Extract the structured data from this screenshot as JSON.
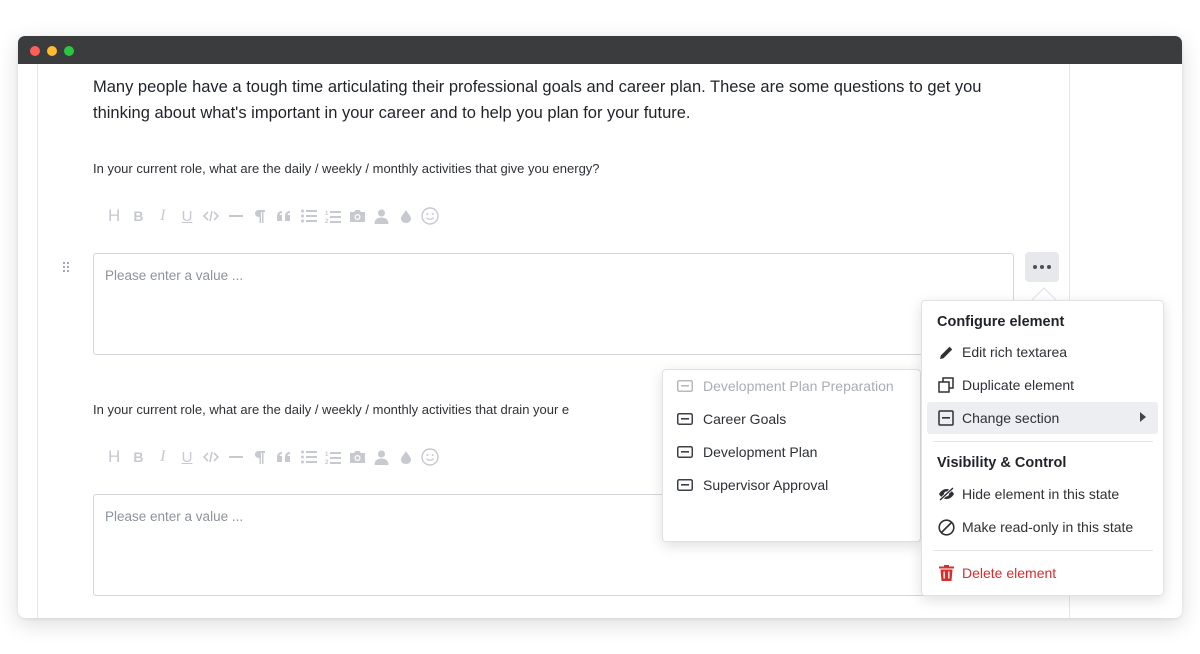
{
  "window": {
    "controls": [
      "close",
      "minimize",
      "zoom"
    ]
  },
  "intro": {
    "text": "Many people have a tough time articulating their professional goals and career plan. These are some questions to get you thinking about what's important in your career and to help you plan for your future."
  },
  "questions": [
    {
      "label": "In your current role, what are the daily / weekly / monthly activities that give you energy?",
      "placeholder": "Please enter a value ..."
    },
    {
      "label": "In your current role, what are the daily / weekly / monthly activities that drain your e",
      "placeholder": "Please enter a value ..."
    }
  ],
  "toolbar": {
    "icons": [
      "heading-icon",
      "bold-icon",
      "italic-icon",
      "underline-icon",
      "code-icon",
      "horizontal-rule-icon",
      "paragraph-icon",
      "blockquote-icon",
      "bullet-list-icon",
      "ordered-list-icon",
      "image-icon",
      "user-icon",
      "drop-icon",
      "emoji-icon"
    ],
    "glyphs": {
      "heading": "H",
      "bold": "B",
      "italic": "I",
      "underline": "U"
    }
  },
  "context_menu": {
    "configure_heading": "Configure element",
    "items": [
      {
        "label": "Edit rich textarea",
        "icon": "pencil-icon"
      },
      {
        "label": "Duplicate element",
        "icon": "duplicate-icon"
      },
      {
        "label": "Change section",
        "icon": "section-icon",
        "has_submenu": true,
        "active": true
      }
    ],
    "visibility_heading": "Visibility & Control",
    "visibility_items": [
      {
        "label": "Hide element in this state",
        "icon": "eye-slash-icon"
      },
      {
        "label": "Make read-only in this state",
        "icon": "ban-icon"
      }
    ],
    "delete_label": "Delete element",
    "delete_color": "#d32f2f"
  },
  "submenu": {
    "items": [
      {
        "label": "Development Plan Preparation",
        "disabled": true
      },
      {
        "label": "Career Goals",
        "disabled": false
      },
      {
        "label": "Development Plan",
        "disabled": false
      },
      {
        "label": "Supervisor Approval",
        "disabled": false
      }
    ]
  }
}
